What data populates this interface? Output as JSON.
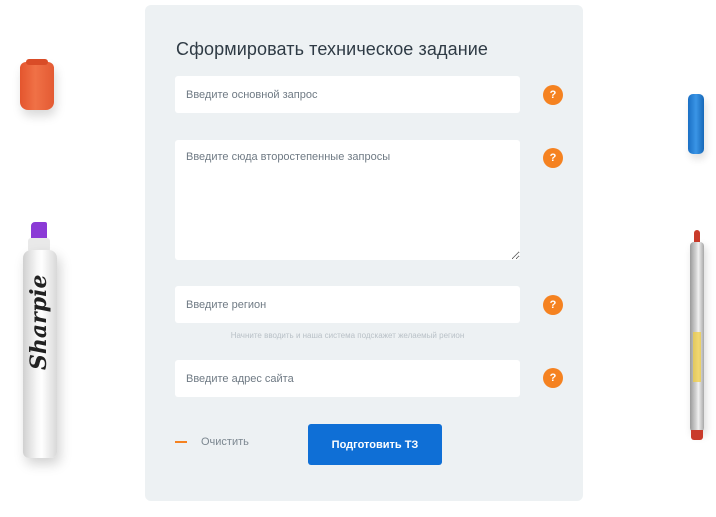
{
  "form": {
    "title": "Сформировать техническое задание",
    "main_query_placeholder": "Введите основной запрос",
    "secondary_queries_placeholder": "Введите сюда второстепенные запросы",
    "region_placeholder": "Введите регион",
    "region_hint": "Начните вводить и наша система подскажет желаемый регион",
    "site_placeholder": "Введите адрес сайта",
    "help_glyph": "?",
    "clear_label": "Очистить",
    "submit_label": "Подготовить ТЗ"
  },
  "decor": {
    "marker_brand": "Sharpie"
  },
  "colors": {
    "accent_orange": "#f58220",
    "primary_blue": "#0f6fd6",
    "panel_background": "#edf1f3"
  }
}
